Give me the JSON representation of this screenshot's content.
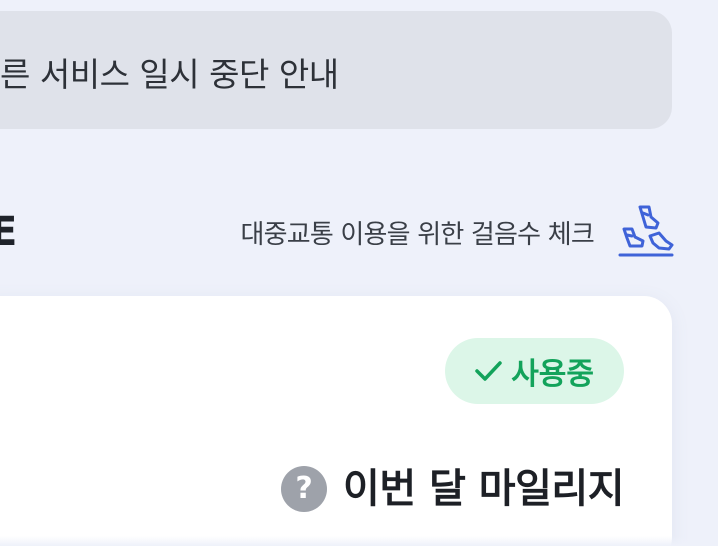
{
  "notice": {
    "text": "른 서비스 일시 중단 안내"
  },
  "section": {
    "title_fragment": "E"
  },
  "walk_check": {
    "label": "대중교통 이용을 위한 걸음수 체크",
    "icon": "walking-shoes-icon",
    "icon_color": "#3f63d8"
  },
  "card": {
    "status_badge": {
      "label": "사용중",
      "icon": "check-icon",
      "color": "#13a35b",
      "background": "#dcf6e8"
    },
    "mileage": {
      "help_icon_glyph": "?",
      "title": "이번 달 마일리지"
    }
  }
}
